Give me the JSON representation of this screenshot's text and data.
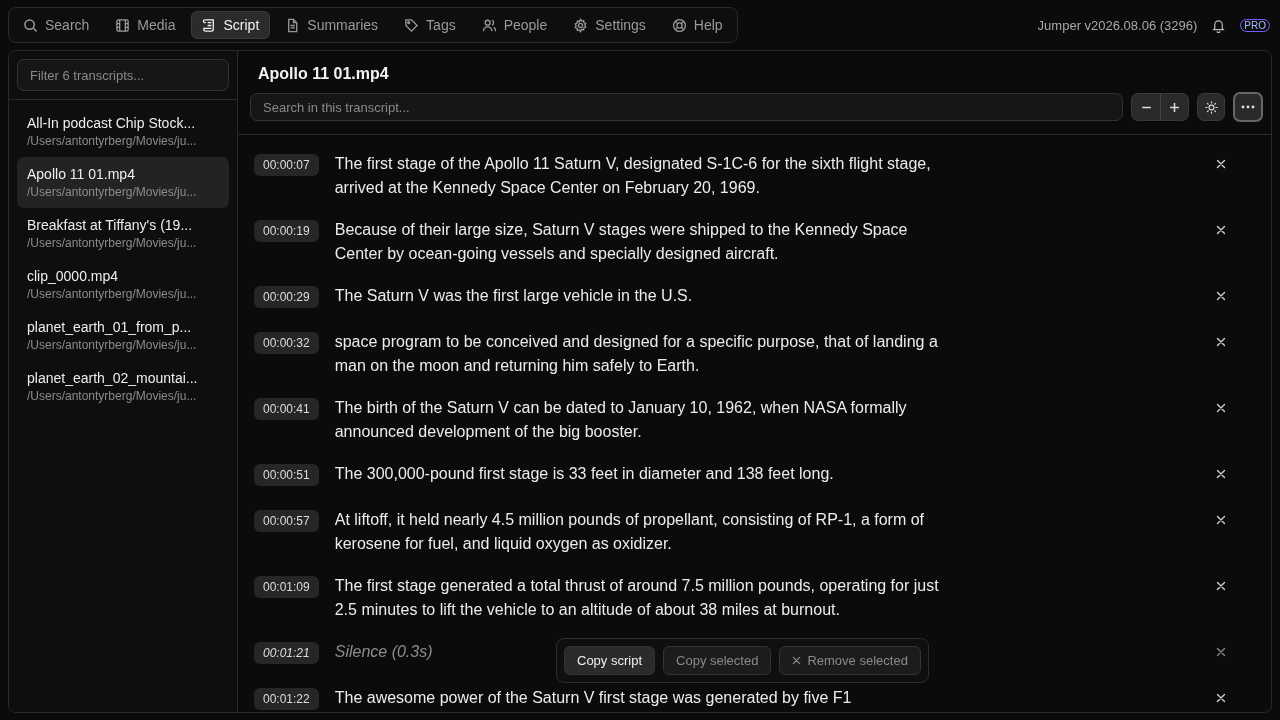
{
  "nav": {
    "tabs": [
      {
        "label": "Search",
        "selected": false
      },
      {
        "label": "Media",
        "selected": false
      },
      {
        "label": "Script",
        "selected": true
      },
      {
        "label": "Summaries",
        "selected": false
      },
      {
        "label": "Tags",
        "selected": false
      },
      {
        "label": "People",
        "selected": false
      },
      {
        "label": "Settings",
        "selected": false
      },
      {
        "label": "Help",
        "selected": false
      }
    ],
    "version": "Jumper v2026.08.06 (3296)",
    "badge": "PRO"
  },
  "sidebar": {
    "filter": {
      "placeholder": "Filter 6 transcripts..."
    },
    "items": [
      {
        "title": "All-In podcast Chip Stock...",
        "path": "/Users/antontyrberg/Movies/ju...",
        "selected": false
      },
      {
        "title": "Apollo 11 01.mp4",
        "path": "/Users/antontyrberg/Movies/ju...",
        "selected": true
      },
      {
        "title": "Breakfast at Tiffany's (19...",
        "path": "/Users/antontyrberg/Movies/ju...",
        "selected": false
      },
      {
        "title": "clip_0000.mp4",
        "path": "/Users/antontyrberg/Movies/ju...",
        "selected": false
      },
      {
        "title": "planet_earth_01_from_p...",
        "path": "/Users/antontyrberg/Movies/ju...",
        "selected": false
      },
      {
        "title": "planet_earth_02_mountai...",
        "path": "/Users/antontyrberg/Movies/ju...",
        "selected": false
      }
    ]
  },
  "transcript": {
    "title": "Apollo 11 01.mp4",
    "search": {
      "placeholder": "Search in this transcript..."
    },
    "segments": [
      {
        "time": "00:00:07",
        "kind": "speech",
        "text": "The first stage of the Apollo 11 Saturn V, designated S-1C-6 for the sixth flight stage, arrived at the Kennedy Space Center on February 20, 1969."
      },
      {
        "time": "00:00:19",
        "kind": "speech",
        "text": "Because of their large size, Saturn V stages were shipped to the Kennedy Space Center by ocean-going vessels and specially designed aircraft."
      },
      {
        "time": "00:00:29",
        "kind": "speech",
        "text": "The Saturn V was the first large vehicle in the U.S."
      },
      {
        "time": "00:00:32",
        "kind": "speech",
        "text": "space program to be conceived and designed for a specific purpose, that of landing a man on the moon and returning him safely to Earth."
      },
      {
        "time": "00:00:41",
        "kind": "speech",
        "text": "The birth of the Saturn V can be dated to January 10, 1962, when NASA formally announced development of the big booster."
      },
      {
        "time": "00:00:51",
        "kind": "speech",
        "text": "The 300,000-pound first stage is 33 feet in diameter and 138 feet long."
      },
      {
        "time": "00:00:57",
        "kind": "speech",
        "text": "At liftoff, it held nearly 4.5 million pounds of propellant, consisting of RP-1, a form of kerosene for fuel, and liquid oxygen as oxidizer."
      },
      {
        "time": "00:01:09",
        "kind": "speech",
        "text": "The first stage generated a total thrust of around 7.5 million pounds, operating for just 2.5 minutes to lift the vehicle to an altitude of about 38 miles at burnout."
      },
      {
        "time": "00:01:21",
        "kind": "silence",
        "text": "Silence (0.3s)"
      },
      {
        "time": "00:01:22",
        "kind": "speech",
        "text": "The awesome power of the Saturn V first stage was generated by five F1"
      }
    ],
    "actions": [
      {
        "label": "Copy script",
        "disabled": false,
        "kind": "plain"
      },
      {
        "label": "Copy selected",
        "disabled": true,
        "kind": "plain"
      },
      {
        "label": "Remove selected",
        "disabled": true,
        "kind": "remove"
      }
    ]
  }
}
